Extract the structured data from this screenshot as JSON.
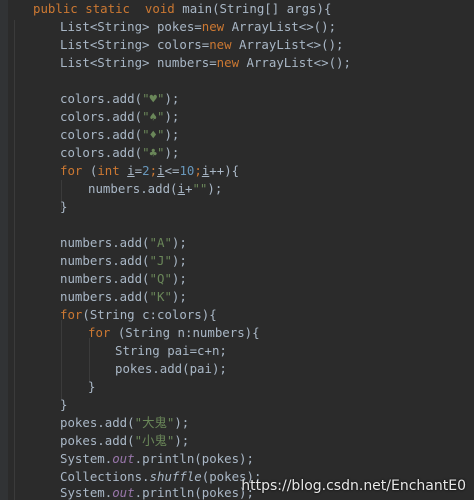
{
  "code": {
    "method_sig": {
      "kw_public": "public",
      "kw_static": "static",
      "kw_void": "void",
      "rest": "main(String[] args){"
    },
    "decl_pokes": {
      "left": "List<String> pokes=",
      "kw_new": "new",
      "right": " ArrayList<>();"
    },
    "decl_colors": {
      "left": "List<String> colors=",
      "kw_new": "new",
      "right": " ArrayList<>();"
    },
    "decl_numbers": {
      "left": "List<String> numbers=",
      "kw_new": "new",
      "right": " ArrayList<>();"
    },
    "color_adds": [
      {
        "call": "colors.add(",
        "arg": "\"♥\"",
        "end": ");"
      },
      {
        "call": "colors.add(",
        "arg": "\"♠\"",
        "end": ");"
      },
      {
        "call": "colors.add(",
        "arg": "\"♦\"",
        "end": ");"
      },
      {
        "call": "colors.add(",
        "arg": "\"♣\"",
        "end": ");"
      }
    ],
    "for_loop": {
      "kw_for": "for",
      "open": " (",
      "kw_int": "int",
      "var1": "i",
      "assign": "=",
      "start": "2",
      "semi1": ";",
      "var2": "i",
      "cmp": "<=",
      "end": "10",
      "semi2": ";",
      "var3": "i",
      "inc": "++){"
    },
    "numbers_add_i": {
      "call": "numbers.add(",
      "var": "i",
      "plus": "+",
      "str": "\"\"",
      "end": ");"
    },
    "close_brace": "}",
    "number_adds": [
      {
        "call": "numbers.add(",
        "arg": "\"A\"",
        "end": ");"
      },
      {
        "call": "numbers.add(",
        "arg": "\"J\"",
        "end": ");"
      },
      {
        "call": "numbers.add(",
        "arg": "\"Q\"",
        "end": ");"
      },
      {
        "call": "numbers.add(",
        "arg": "\"K\"",
        "end": ");"
      }
    ],
    "for_colors": {
      "kw_for": "for",
      "rest": "(String c:colors){"
    },
    "for_numbers": {
      "kw_for": "for",
      "rest": " (String n:numbers){"
    },
    "pai_decl": "String pai=c+n;",
    "pokes_add_pai": "pokes.add(pai);",
    "pokes_adds": [
      {
        "call": "pokes.add(",
        "arg": "\"大鬼\"",
        "end": ");"
      },
      {
        "call": "pokes.add(",
        "arg": "\"小鬼\"",
        "end": ");"
      }
    ],
    "println1": {
      "cls": "System.",
      "field": "out",
      "rest": ".println(pokes);"
    },
    "shuffle": {
      "cls": "Collections.",
      "method": "shuffle",
      "rest": "(pokes);"
    },
    "println2": {
      "cls": "System.",
      "field": "out",
      "rest": ".println(pokes);"
    }
  },
  "watermark": "https://blog.csdn.net/EnchantE0",
  "colors": {
    "background": "#2b2b2b",
    "keyword": "#cc7832",
    "string": "#6a8759",
    "number": "#6897bb",
    "field": "#9876aa",
    "text": "#a9b7c6"
  }
}
